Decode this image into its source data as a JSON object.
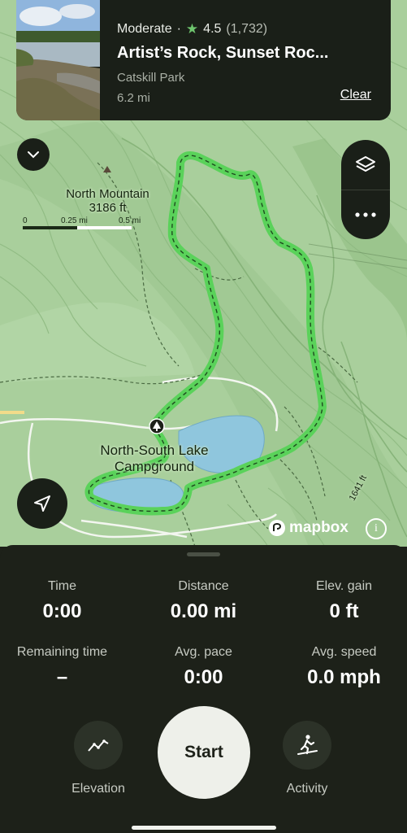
{
  "trail_card": {
    "difficulty": "Moderate",
    "separator": "·",
    "rating": "4.5",
    "review_count": "(1,732)",
    "name": "Artist’s Rock, Sunset Roc...",
    "park": "Catskill Park",
    "distance": "6.2 mi",
    "clear_label": "Clear"
  },
  "map": {
    "peak_name": "North Mountain",
    "peak_elevation": "3186 ft",
    "campground_line1": "North-South Lake",
    "campground_line2": "Campground",
    "contour_label": "1641 ft",
    "scale_labels": [
      "0",
      "0.25 mi",
      "0.5 mi"
    ],
    "attribution": "mapbox",
    "trail_color": "#5ad25a",
    "water_color": "#8fc6dd"
  },
  "stats": {
    "time_label": "Time",
    "time_value": "0:00",
    "distance_label": "Distance",
    "distance_value": "0.00 mi",
    "elev_label": "Elev. gain",
    "elev_value": "0 ft",
    "remaining_label": "Remaining time",
    "remaining_value": "–",
    "pace_label": "Avg. pace",
    "pace_value": "0:00",
    "speed_label": "Avg. speed",
    "speed_value": "0.0 mph"
  },
  "controls": {
    "elevation_label": "Elevation",
    "start_label": "Start",
    "activity_label": "Activity"
  },
  "icons": [
    "chevron-down-icon",
    "layers-icon",
    "more-icon",
    "navigation-arrow-icon",
    "star-icon",
    "campground-icon",
    "peak-icon",
    "elevation-chart-icon",
    "hiker-icon",
    "mapbox-logo",
    "info-icon"
  ]
}
